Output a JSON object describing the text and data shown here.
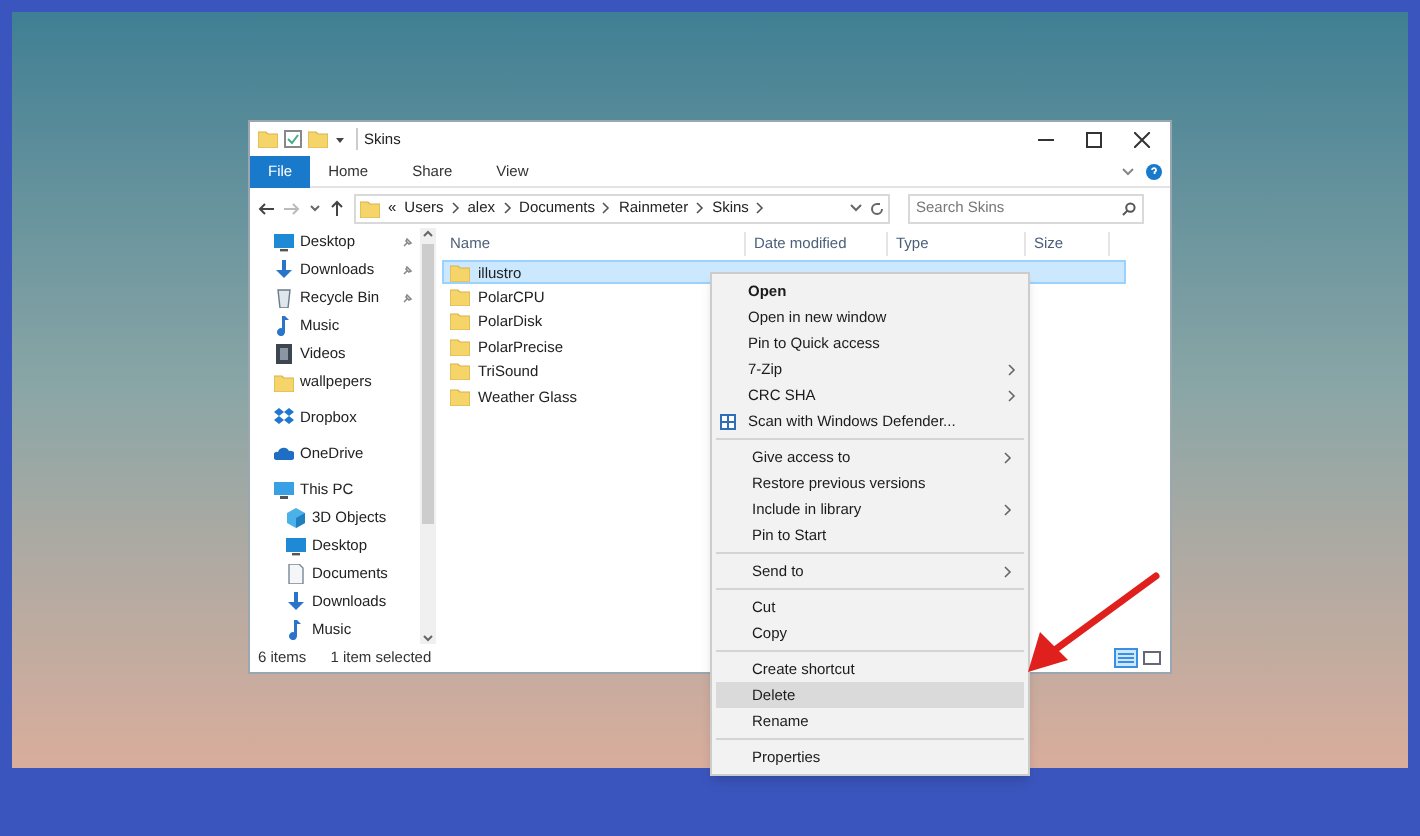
{
  "window": {
    "title": "Skins"
  },
  "ribbon_tabs": [
    {
      "label": "File",
      "selected": true
    },
    {
      "label": "Home",
      "selected": false
    },
    {
      "label": "Share",
      "selected": false
    },
    {
      "label": "View",
      "selected": false
    }
  ],
  "address": {
    "segments": [
      "«",
      "Users",
      "alex",
      "Documents",
      "Rainmeter",
      "Skins"
    ]
  },
  "search": {
    "placeholder": "Search Skins"
  },
  "nav_sections": [
    [
      {
        "label": "Desktop",
        "kind": "desktop",
        "pinned": true
      },
      {
        "label": "Downloads",
        "kind": "download",
        "pinned": true
      },
      {
        "label": "Recycle Bin",
        "kind": "recycle",
        "pinned": true
      },
      {
        "label": "Music",
        "kind": "music",
        "pinned": false
      },
      {
        "label": "Videos",
        "kind": "video",
        "pinned": false
      },
      {
        "label": "wallpepers",
        "kind": "folder",
        "pinned": false
      }
    ],
    [
      {
        "label": "Dropbox",
        "kind": "dropbox",
        "pinned": false
      }
    ],
    [
      {
        "label": "OneDrive",
        "kind": "cloud",
        "pinned": false
      }
    ],
    [
      {
        "label": "This PC",
        "kind": "pc",
        "pinned": false,
        "children": [
          {
            "label": "3D Objects",
            "kind": "cube",
            "pinned": false
          },
          {
            "label": "Desktop",
            "kind": "desktop",
            "pinned": false
          },
          {
            "label": "Documents",
            "kind": "document",
            "pinned": false
          },
          {
            "label": "Downloads",
            "kind": "download",
            "pinned": false
          },
          {
            "label": "Music",
            "kind": "music",
            "pinned": false
          }
        ]
      }
    ]
  ],
  "columns": [
    "Name",
    "Date modified",
    "Type",
    "Size"
  ],
  "files": [
    {
      "name": "illustro",
      "selected": true
    },
    {
      "name": "PolarCPU",
      "selected": false
    },
    {
      "name": "PolarDisk",
      "selected": false
    },
    {
      "name": "PolarPrecise",
      "selected": false
    },
    {
      "name": "TriSound",
      "selected": false
    },
    {
      "name": "Weather Glass",
      "selected": false
    }
  ],
  "status_bar": {
    "count": "6 items",
    "selection": "1 item selected"
  },
  "context_menu": [
    [
      {
        "label": "Open",
        "default": true,
        "submenu": false,
        "has_icon": false,
        "highlighted": false
      },
      {
        "label": "Open in new window",
        "default": false,
        "submenu": false,
        "has_icon": false,
        "highlighted": false
      },
      {
        "label": "Pin to Quick access",
        "default": false,
        "submenu": false,
        "has_icon": false,
        "highlighted": false
      },
      {
        "label": "7-Zip",
        "default": false,
        "submenu": true,
        "has_icon": false,
        "highlighted": false
      },
      {
        "label": "CRC SHA",
        "default": false,
        "submenu": true,
        "has_icon": false,
        "highlighted": false
      },
      {
        "label": "Scan with Windows Defender...",
        "default": false,
        "submenu": false,
        "has_icon": true,
        "highlighted": false
      }
    ],
    [
      {
        "label": "Give access to",
        "default": false,
        "submenu": true,
        "has_icon": false,
        "highlighted": false
      },
      {
        "label": "Restore previous versions",
        "default": false,
        "submenu": false,
        "has_icon": false,
        "highlighted": false
      },
      {
        "label": "Include in library",
        "default": false,
        "submenu": true,
        "has_icon": false,
        "highlighted": false
      },
      {
        "label": "Pin to Start",
        "default": false,
        "submenu": false,
        "has_icon": false,
        "highlighted": false
      }
    ],
    [
      {
        "label": "Send to",
        "default": false,
        "submenu": true,
        "has_icon": false,
        "highlighted": false
      }
    ],
    [
      {
        "label": "Cut",
        "default": false,
        "submenu": false,
        "has_icon": false,
        "highlighted": false
      },
      {
        "label": "Copy",
        "default": false,
        "submenu": false,
        "has_icon": false,
        "highlighted": false
      }
    ],
    [
      {
        "label": "Create shortcut",
        "default": false,
        "submenu": false,
        "has_icon": false,
        "highlighted": false
      },
      {
        "label": "Delete",
        "default": false,
        "submenu": false,
        "has_icon": false,
        "highlighted": true
      },
      {
        "label": "Rename",
        "default": false,
        "submenu": false,
        "has_icon": false,
        "highlighted": false
      }
    ],
    [
      {
        "label": "Properties",
        "default": false,
        "submenu": false,
        "has_icon": false,
        "highlighted": false
      }
    ]
  ]
}
